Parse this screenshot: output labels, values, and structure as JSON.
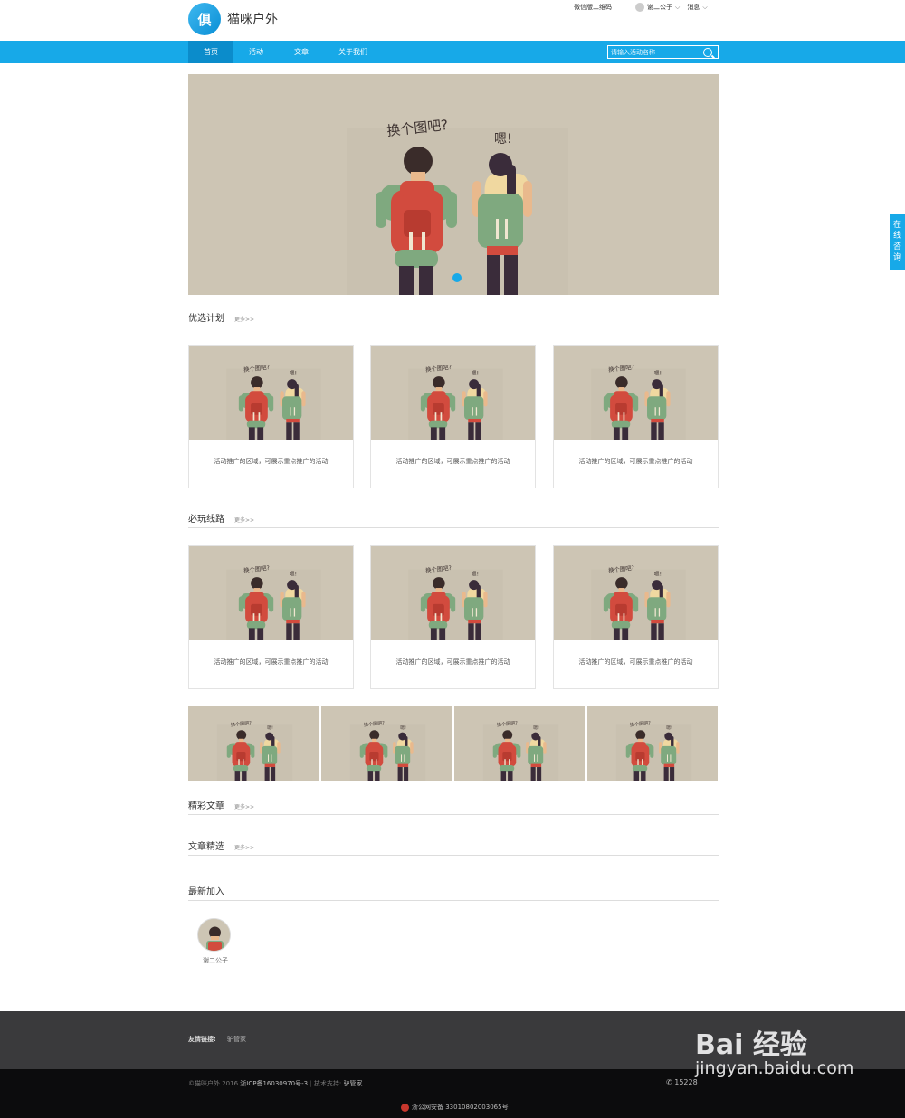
{
  "header": {
    "logo_char": "俱",
    "site_name": "猫咪户外",
    "wechat_qr": "微信版二维码",
    "username": "谢二公子",
    "messages": "消息"
  },
  "nav": {
    "items": [
      {
        "label": "首页"
      },
      {
        "label": "活动"
      },
      {
        "label": "文章"
      },
      {
        "label": "关于我们"
      }
    ],
    "search_placeholder": "请输入活动名称"
  },
  "illustration": {
    "speech_left": "换个图吧?",
    "speech_right": "嗯!"
  },
  "sections": {
    "featured": {
      "title": "优选计划",
      "more": "更多>>"
    },
    "routes": {
      "title": "必玩线路",
      "more": "更多>>"
    },
    "articles": {
      "title": "精彩文章",
      "more": "更多>>"
    },
    "picks": {
      "title": "文章精选",
      "more": "更多>>"
    },
    "newest": {
      "title": "最新加入"
    }
  },
  "cards": {
    "caption": "活动推广的区域，可展示重点推广的活动"
  },
  "member": {
    "name": "谢二公子"
  },
  "footer": {
    "links_label": "友情链接:",
    "link1": "驴管家",
    "copyright": "©猫咪户外 2016",
    "icp": "浙ICP备16030970号-3",
    "sep": " | ",
    "tech": "技术支持:",
    "tech_name": "驴管家",
    "phone": "15228",
    "police": "浙公网安备 33010802003065号"
  },
  "side": {
    "consult": "在线咨询"
  },
  "watermark": {
    "line1": "Bai 经验",
    "line2": "jingyan.baidu.com"
  },
  "colors": {
    "accent": "#17a9e8",
    "banner_bg": "#cdc5b4",
    "footer_dark": "#3a3a3c",
    "footer_black": "#0c0c0d"
  }
}
